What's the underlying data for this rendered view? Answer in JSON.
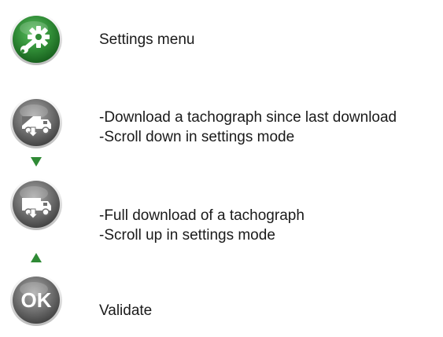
{
  "legend": {
    "settings": {
      "icon": "settings-wrench-gear-icon",
      "color": "#2f8a35",
      "lines": [
        "Settings menu"
      ]
    },
    "download_since_last": {
      "icon": "truck-partial-download-icon",
      "color": "#6f6f6f",
      "lines": [
        "-Download a tachograph since last download",
        "-Scroll down in settings mode"
      ]
    },
    "full_download": {
      "icon": "truck-full-download-icon",
      "color": "#6f6f6f",
      "lines": [
        "-Full download of a tachograph",
        "-Scroll up in settings mode"
      ]
    },
    "validate": {
      "icon": "ok-button-icon",
      "label": "OK",
      "color": "#6f6f6f",
      "lines": [
        "Validate"
      ]
    }
  },
  "arrows": {
    "down": {
      "icon": "arrow-down-icon",
      "color": "#2f8a35"
    },
    "up": {
      "icon": "arrow-up-icon",
      "color": "#2f8a35"
    }
  }
}
